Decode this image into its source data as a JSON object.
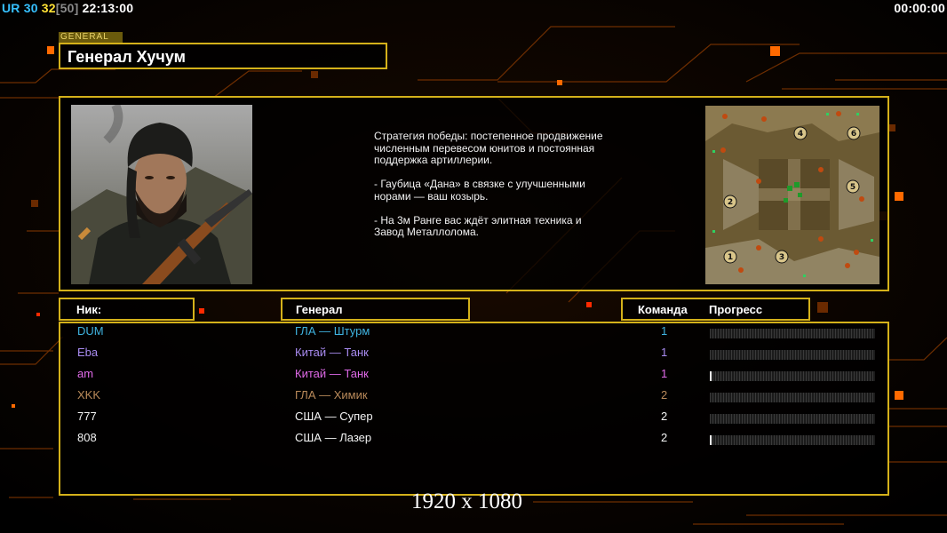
{
  "hud": {
    "left": [
      {
        "text": "UR",
        "color": "#36c0ff"
      },
      {
        "text": " 30",
        "color": "#36c0ff"
      },
      {
        "text": " 32",
        "color": "#ffe135"
      },
      {
        "text": "[50]",
        "color": "#8a8a8a"
      },
      {
        "text": " 22:13:00",
        "color": "#ffffff"
      }
    ],
    "right_timer": "00:00:00"
  },
  "general": {
    "tag": "GENERAL",
    "name": "Генерал Хучум"
  },
  "description": [
    "Стратегия победы: постепенное продвижение численным перевесом юнитов и постоянная поддержка артиллерии.",
    "- Гаубица «Дана» в связке с улучшенными норами — ваш козырь.",
    "- На 3м Ранге вас ждёт элитная техника и Завод Металлолома."
  ],
  "minimap": {
    "start_positions": [
      "1",
      "2",
      "3",
      "4",
      "5",
      "6"
    ]
  },
  "table": {
    "headers": {
      "nick": "Ник:",
      "general": "Генерал",
      "team": "Команда",
      "progress": "Прогресс"
    },
    "rows": [
      {
        "nick": "DUM",
        "general": "ГЛА — Штурм",
        "team": "1",
        "color": "#3fb3e0",
        "progress": 0
      },
      {
        "nick": "Eba",
        "general": "Китай — Танк",
        "team": "1",
        "color": "#a98bf0",
        "progress": 0
      },
      {
        "nick": "am",
        "general": "Китай — Танк",
        "team": "1",
        "color": "#e06ae8",
        "progress": 0.01
      },
      {
        "nick": "XKK",
        "general": "ГЛА — Химик",
        "team": "2",
        "color": "#b98a5a",
        "progress": 0
      },
      {
        "nick": "777",
        "general": "США — Супер",
        "team": "2",
        "color": "#f4f4f4",
        "progress": 0
      },
      {
        "nick": "808",
        "general": "США — Лазер",
        "team": "2",
        "color": "#f4f4f4",
        "progress": 0.01
      }
    ]
  },
  "resolution": "1920 x 1080",
  "colors": {
    "accent": "#d4b11a",
    "circuit": "#ff6a00"
  }
}
